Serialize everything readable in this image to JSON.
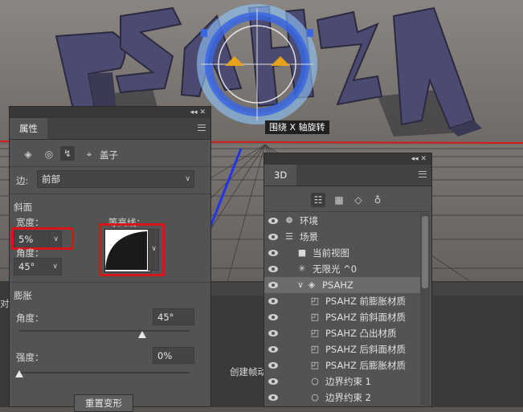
{
  "scene": {
    "text_letters": "PSAHZ",
    "gizmo_tooltip": "围绕 X 轴旋转"
  },
  "background": {
    "frame_label": "创建帧动",
    "left_edge_text": "对"
  },
  "properties_panel": {
    "tab": "属性",
    "header_controls": "◂◂  ✕",
    "mode_label": "盖子",
    "edge_label": "边:",
    "edge_value": "前部",
    "bevel_section": "斜面",
    "width_label": "宽度：",
    "width_value": "5%",
    "contour_label": "等高线：",
    "angle_label_bevel": "角度：",
    "angle_value_bevel": "45°",
    "inflate_section": "膨胀",
    "angle_label": "角度：",
    "angle_value": "45°",
    "angle_slider_fraction": 0.72,
    "strength_label": "强度：",
    "strength_value": "0%",
    "strength_slider_fraction": 0.0,
    "reset_button": "重置变形",
    "icons": [
      "mesh-icon",
      "deform-icon",
      "cap-icon",
      "coordinates-icon"
    ]
  },
  "panel_3d": {
    "tab": "3D",
    "header_controls": "◂◂  ✕",
    "filter_icons": [
      "whole-scene-icon",
      "mesh-filter-icon",
      "material-filter-icon",
      "light-filter-icon"
    ],
    "rows": [
      {
        "label": "环境",
        "icon": "environment-icon",
        "indent": 0,
        "selected": false,
        "expander": ""
      },
      {
        "label": "场景",
        "icon": "scene-icon",
        "indent": 0,
        "selected": false,
        "expander": ""
      },
      {
        "label": "当前视图",
        "icon": "camera-icon",
        "indent": 1,
        "selected": false,
        "expander": ""
      },
      {
        "label": "无限光 ^0",
        "icon": "infinite-light-icon",
        "indent": 1,
        "selected": false,
        "expander": ""
      },
      {
        "label": "PSAHZ",
        "icon": "mesh-icon",
        "indent": 1,
        "selected": true,
        "expander": "∨"
      },
      {
        "label": "PSAHZ 前膨胀材质",
        "icon": "material-icon",
        "indent": 2,
        "selected": false,
        "expander": ""
      },
      {
        "label": "PSAHZ 前斜面材质",
        "icon": "material-icon",
        "indent": 2,
        "selected": false,
        "expander": ""
      },
      {
        "label": "PSAHZ 凸出材质",
        "icon": "material-icon",
        "indent": 2,
        "selected": false,
        "expander": ""
      },
      {
        "label": "PSAHZ 后斜面材质",
        "icon": "material-icon",
        "indent": 2,
        "selected": false,
        "expander": ""
      },
      {
        "label": "PSAHZ 后膨胀材质",
        "icon": "material-icon",
        "indent": 2,
        "selected": false,
        "expander": ""
      },
      {
        "label": "边界约束 1",
        "icon": "constraint-icon",
        "indent": 2,
        "selected": false,
        "expander": ""
      },
      {
        "label": "边界约束 2",
        "icon": "constraint-icon",
        "indent": 2,
        "selected": false,
        "expander": ""
      }
    ]
  },
  "colors": {
    "panel_bg": "#535353",
    "highlight_box": "#d4161b",
    "letters": "#4b4a70",
    "gizmo_blue": "#3a66e0"
  }
}
